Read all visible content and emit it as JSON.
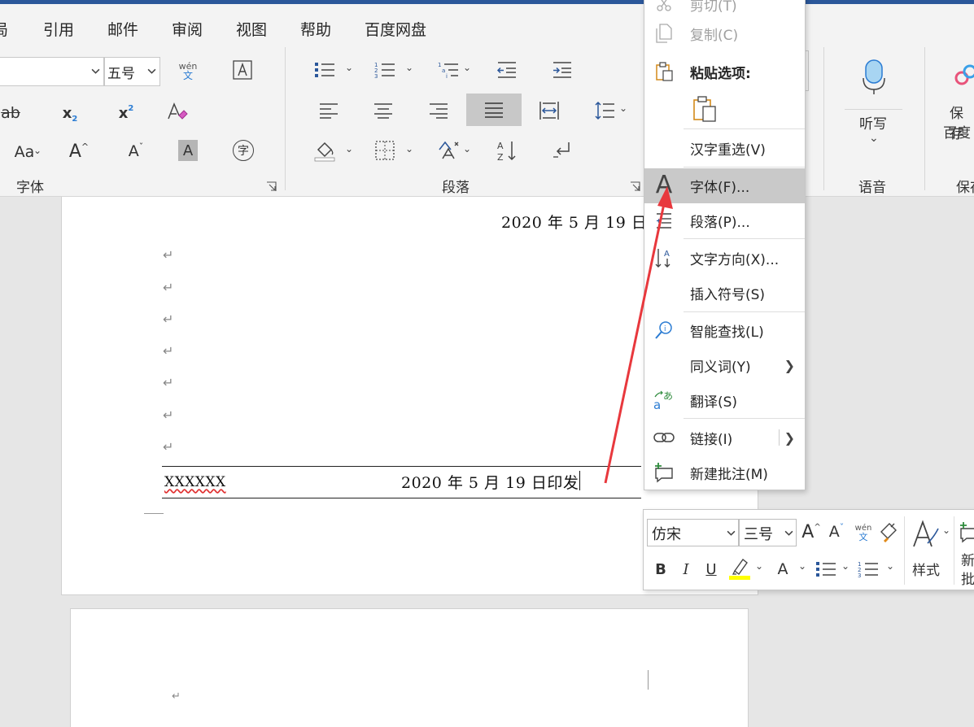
{
  "tabs": [
    "局",
    "引用",
    "邮件",
    "审阅",
    "视图",
    "帮助",
    "百度网盘"
  ],
  "ribbon": {
    "font_group": {
      "label": "字体",
      "font_size_value": "五号",
      "phonetic_top": "wén",
      "phonetic_bottom": "文",
      "strike_label": "ab",
      "sub_label": "x",
      "sub_index": "2",
      "sup_label": "x",
      "sup_index": "2",
      "change_case_label": "Aa",
      "grow_label": "A",
      "shrink_label": "A",
      "shade_label": "A",
      "enclose_label": "字"
    },
    "paragraph_group": {
      "label": "段落"
    },
    "voice_group": {
      "dictate_label": "听写",
      "label": "语音"
    },
    "save_group": {
      "line1": "保存",
      "line2": "百度",
      "label": "保存"
    }
  },
  "document": {
    "date_top": "2020 年 5 月 19 日",
    "footer_left": "XXXXXX",
    "footer_right": "2020 年 5 月 19 日印发",
    "paragraph_mark": "↵"
  },
  "context_menu": {
    "cut": "剪切(T)",
    "copy": "复制(C)",
    "paste_options": "粘贴选项:",
    "items": {
      "reconvert": "汉字重选(V)",
      "font": "字体(F)...",
      "paragraph": "段落(P)...",
      "text_direction": "文字方向(X)...",
      "insert_symbol": "插入符号(S)",
      "smart_lookup": "智能查找(L)",
      "synonyms": "同义词(Y)",
      "translate": "翻译(S)",
      "link": "链接(I)",
      "new_comment": "新建批注(M)"
    },
    "font_icon_letter": "A",
    "highlighted": "font"
  },
  "mini_toolbar": {
    "font_name": "仿宋",
    "font_size": "三号",
    "grow_label": "A",
    "shrink_label": "A",
    "phonetic_top": "wén",
    "phonetic_bottom": "文",
    "bold": "B",
    "italic": "I",
    "underline": "U",
    "font_color_label": "A",
    "styles_label": "样式",
    "comment_line1": "新",
    "comment_line2": "批"
  },
  "colors": {
    "accent": "#2b579a",
    "arrow": "#e8383d",
    "highlight_yellow": "#ffff00",
    "phonetic_blue": "#2b7cd3",
    "menu_hover": "#c9c9c9"
  }
}
